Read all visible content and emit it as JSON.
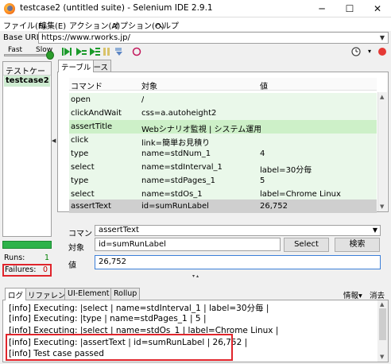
{
  "window": {
    "title": "testcase2 (untitled suite) - Selenium IDE 2.9.1",
    "minimize": "─",
    "maximize": "☐",
    "close": "✕"
  },
  "menu": [
    "ファイル(F)",
    "編集(E)",
    "アクション(A)",
    "オプション(O)",
    "ヘルプ"
  ],
  "base_url": {
    "label": "Base URL",
    "value": "https://www.rworks.jp/"
  },
  "speed": {
    "fast": "Fast",
    "slow": "Slow"
  },
  "icons": {
    "play_all": "play-all-icon",
    "play_current": "play-current-icon",
    "pause": "pause-icon",
    "step": "step-icon",
    "rollup": "rollup-icon",
    "schedule": "clock-icon",
    "record": "record-icon"
  },
  "left_panel": {
    "header": "テストケース",
    "testcase": "testcase2"
  },
  "counters": {
    "runs_label": "Runs:",
    "runs_value": "1",
    "failures_label": "Failures:",
    "failures_value": "0"
  },
  "editor_tabs": [
    "テーブル",
    "ソース"
  ],
  "table": {
    "headers": [
      "コマンド",
      "対象",
      "値"
    ],
    "rows": [
      {
        "command": "open",
        "target": "/",
        "value": ""
      },
      {
        "command": "clickAndWait",
        "target": "css=a.autoheight2",
        "value": ""
      },
      {
        "command": "assertTitle",
        "target": "Webシナリオ監視 | システム運用監視、...",
        "value": ""
      },
      {
        "command": "click",
        "target": "link=簡単お見積り",
        "value": ""
      },
      {
        "command": "type",
        "target": "name=stdNum_1",
        "value": "4"
      },
      {
        "command": "select",
        "target": "name=stdInterval_1",
        "value": "label=30分毎"
      },
      {
        "command": "type",
        "target": "name=stdPages_1",
        "value": "5"
      },
      {
        "command": "select",
        "target": "name=stdOs_1",
        "value": "label=Chrome Linux"
      },
      {
        "command": "assertText",
        "target": "id=sumRunLabel",
        "value": "26,752"
      }
    ]
  },
  "command_editor": {
    "command_label": "コマンド",
    "command_value": "assertText",
    "target_label": "対象",
    "target_value": "id=sumRunLabel",
    "select_button": "Select",
    "find_button": "検索",
    "value_label": "値",
    "value_value": "26,752"
  },
  "bottom_tabs": [
    "ログ",
    "リファレンス",
    "UI-Element",
    "Rollup"
  ],
  "log_controls": {
    "info": "情報▾",
    "clear": "消去"
  },
  "log_lines": [
    "[info] Executing: |select | name=stdInterval_1 | label=30分毎 |",
    "[info] Executing: |type | name=stdPages_1 | 5 |",
    "[info] Executing: |select | name=stdOs_1 | label=Chrome Linux |",
    "[info] Executing: |assertText | id=sumRunLabel | 26,752 |",
    "[info] Test case passed"
  ]
}
